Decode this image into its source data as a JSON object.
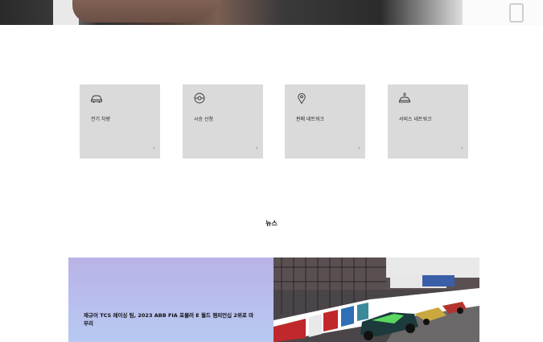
{
  "quick_links": [
    {
      "label": "전기 차량",
      "icon": "car-icon"
    },
    {
      "label": "시승 신청",
      "icon": "steering-wheel-icon"
    },
    {
      "label": "판매 네트워크",
      "icon": "location-pin-icon"
    },
    {
      "label": "서비스 네트워크",
      "icon": "service-car-icon"
    }
  ],
  "arrow": "›",
  "news": {
    "section_title": "뉴스",
    "headline": "재규어 TCS 레이싱 팀, 2023 ABB FIA 포뮬러 E 월드 챔피언십 2위로 마무리"
  }
}
